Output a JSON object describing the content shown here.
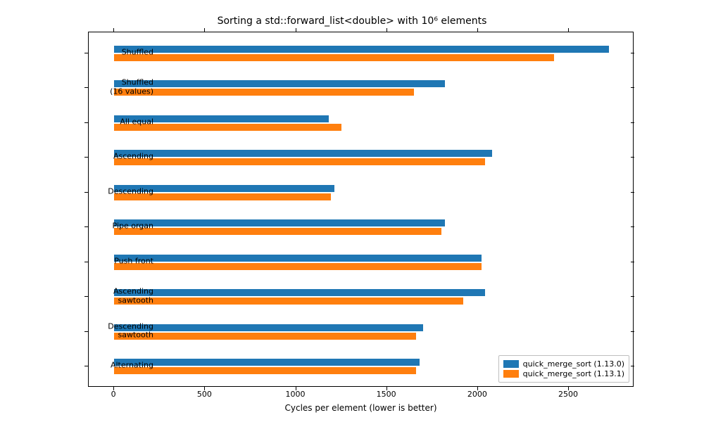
{
  "chart_data": {
    "type": "bar",
    "orientation": "horizontal",
    "title": "Sorting a std::forward_list<double> with 10⁶ elements",
    "xlabel": "Cycles per element (lower is better)",
    "ylabel": "",
    "xlim": [
      -140,
      2860
    ],
    "ylim_categories_top_to_bottom": true,
    "xticks": [
      0,
      500,
      1000,
      1500,
      2000,
      2500
    ],
    "categories": [
      "Shuffled",
      "Shuffled\n(16 values)",
      "All equal",
      "Ascending",
      "Descending",
      "Pipe organ",
      "Push front",
      "Ascending\nsawtooth",
      "Descending\nsawtooth",
      "Alternating"
    ],
    "series": [
      {
        "name": "quick_merge_sort (1.13.0)",
        "color": "#1f77b4",
        "values": [
          2720,
          1820,
          1180,
          2080,
          1210,
          1820,
          2020,
          2040,
          1700,
          1680
        ]
      },
      {
        "name": "quick_merge_sort (1.13.1)",
        "color": "#ff7f0e",
        "values": [
          2420,
          1650,
          1250,
          2040,
          1190,
          1800,
          2020,
          1920,
          1660,
          1660
        ]
      }
    ],
    "legend_position": "lower right"
  }
}
